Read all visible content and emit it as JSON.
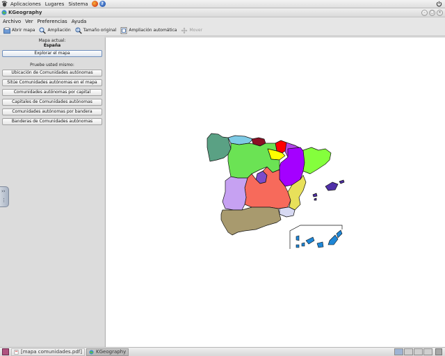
{
  "top_panel": {
    "menus": [
      "Aplicaciones",
      "Lugares",
      "Sistema"
    ],
    "icons": [
      "gnome-foot-icon",
      "firefox-icon",
      "help-icon",
      "power-icon"
    ]
  },
  "window": {
    "title": "KGeography"
  },
  "menubar": [
    "Archivo",
    "Ver",
    "Preferencias",
    "Ayuda"
  ],
  "toolbar": {
    "open_map": "Abrir mapa",
    "zoom": "Ampliación",
    "original_size": "Tamaño original",
    "auto_zoom": "Ampliación automática",
    "move": "Mover"
  },
  "left_panel": {
    "current_map_label": "Mapa actual:",
    "current_map": "España",
    "explore_button": "Explorar el mapa",
    "try_label": "Pruebe usted mismo:",
    "quiz_buttons": [
      "Ubicación de Comunidades autónomas",
      "Sitúe Comunidades autónomas en el mapa",
      "Comunidades autónomas por capital",
      "Capitales de Comunidades autónomas",
      "Comunidades autónomas por bandera",
      "Banderas de Comunidades autónomas"
    ]
  },
  "map": {
    "region_colors": {
      "galicia": "#5aa184",
      "asturias": "#7ecbe6",
      "cantabria": "#8b1024",
      "pais_vasco": "#ff0000",
      "navarra": "#b146e6",
      "la_rioja": "#ffff00",
      "aragon": "#a400ff",
      "cataluna": "#84ff3c",
      "castilla_leon": "#6be354",
      "madrid": "#7b4bc9",
      "castilla_la_mancha": "#f76a5b",
      "extremadura": "#c6a1f2",
      "valencia": "#e8e05a",
      "murcia": "#d7d9f2",
      "andalucia": "#a89a6e",
      "baleares": "#5030a8",
      "canarias": "#1f86d6"
    }
  },
  "taskbar": {
    "tasks": [
      "[mapa comunidades.pdf]",
      "KGeography"
    ]
  }
}
